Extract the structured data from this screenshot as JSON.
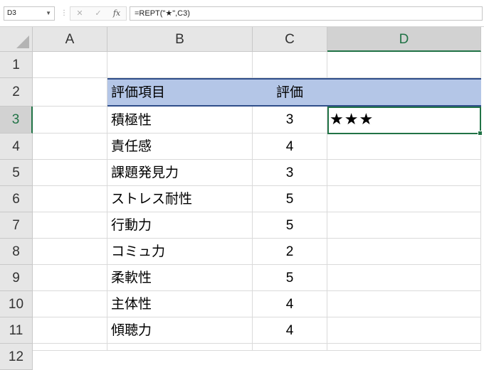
{
  "formula_bar": {
    "name_box": "D3",
    "cancel_icon": "✕",
    "enter_icon": "✓",
    "function_icon": "fx",
    "formula": "=REPT(\"★\",C3)"
  },
  "columns": [
    "A",
    "B",
    "C",
    "D"
  ],
  "active_column": "D",
  "rows": [
    "1",
    "2",
    "3",
    "4",
    "5",
    "6",
    "7",
    "8",
    "9",
    "10",
    "11",
    "12"
  ],
  "active_row": "3",
  "table": {
    "header": {
      "item": "評価項目",
      "rating": "評価",
      "stars": ""
    },
    "rows": [
      {
        "item": "積極性",
        "rating": "3",
        "stars": "★★★"
      },
      {
        "item": "責任感",
        "rating": "4",
        "stars": ""
      },
      {
        "item": "課題発見力",
        "rating": "3",
        "stars": ""
      },
      {
        "item": "ストレス耐性",
        "rating": "5",
        "stars": ""
      },
      {
        "item": "行動力",
        "rating": "5",
        "stars": ""
      },
      {
        "item": "コミュ力",
        "rating": "2",
        "stars": ""
      },
      {
        "item": "柔軟性",
        "rating": "5",
        "stars": ""
      },
      {
        "item": "主体性",
        "rating": "4",
        "stars": ""
      },
      {
        "item": "傾聴力",
        "rating": "4",
        "stars": ""
      }
    ]
  },
  "colors": {
    "accent": "#217346",
    "table_header": "#b4c6e7",
    "table_border": "#2f4d8a"
  },
  "selected_cell": "D3"
}
